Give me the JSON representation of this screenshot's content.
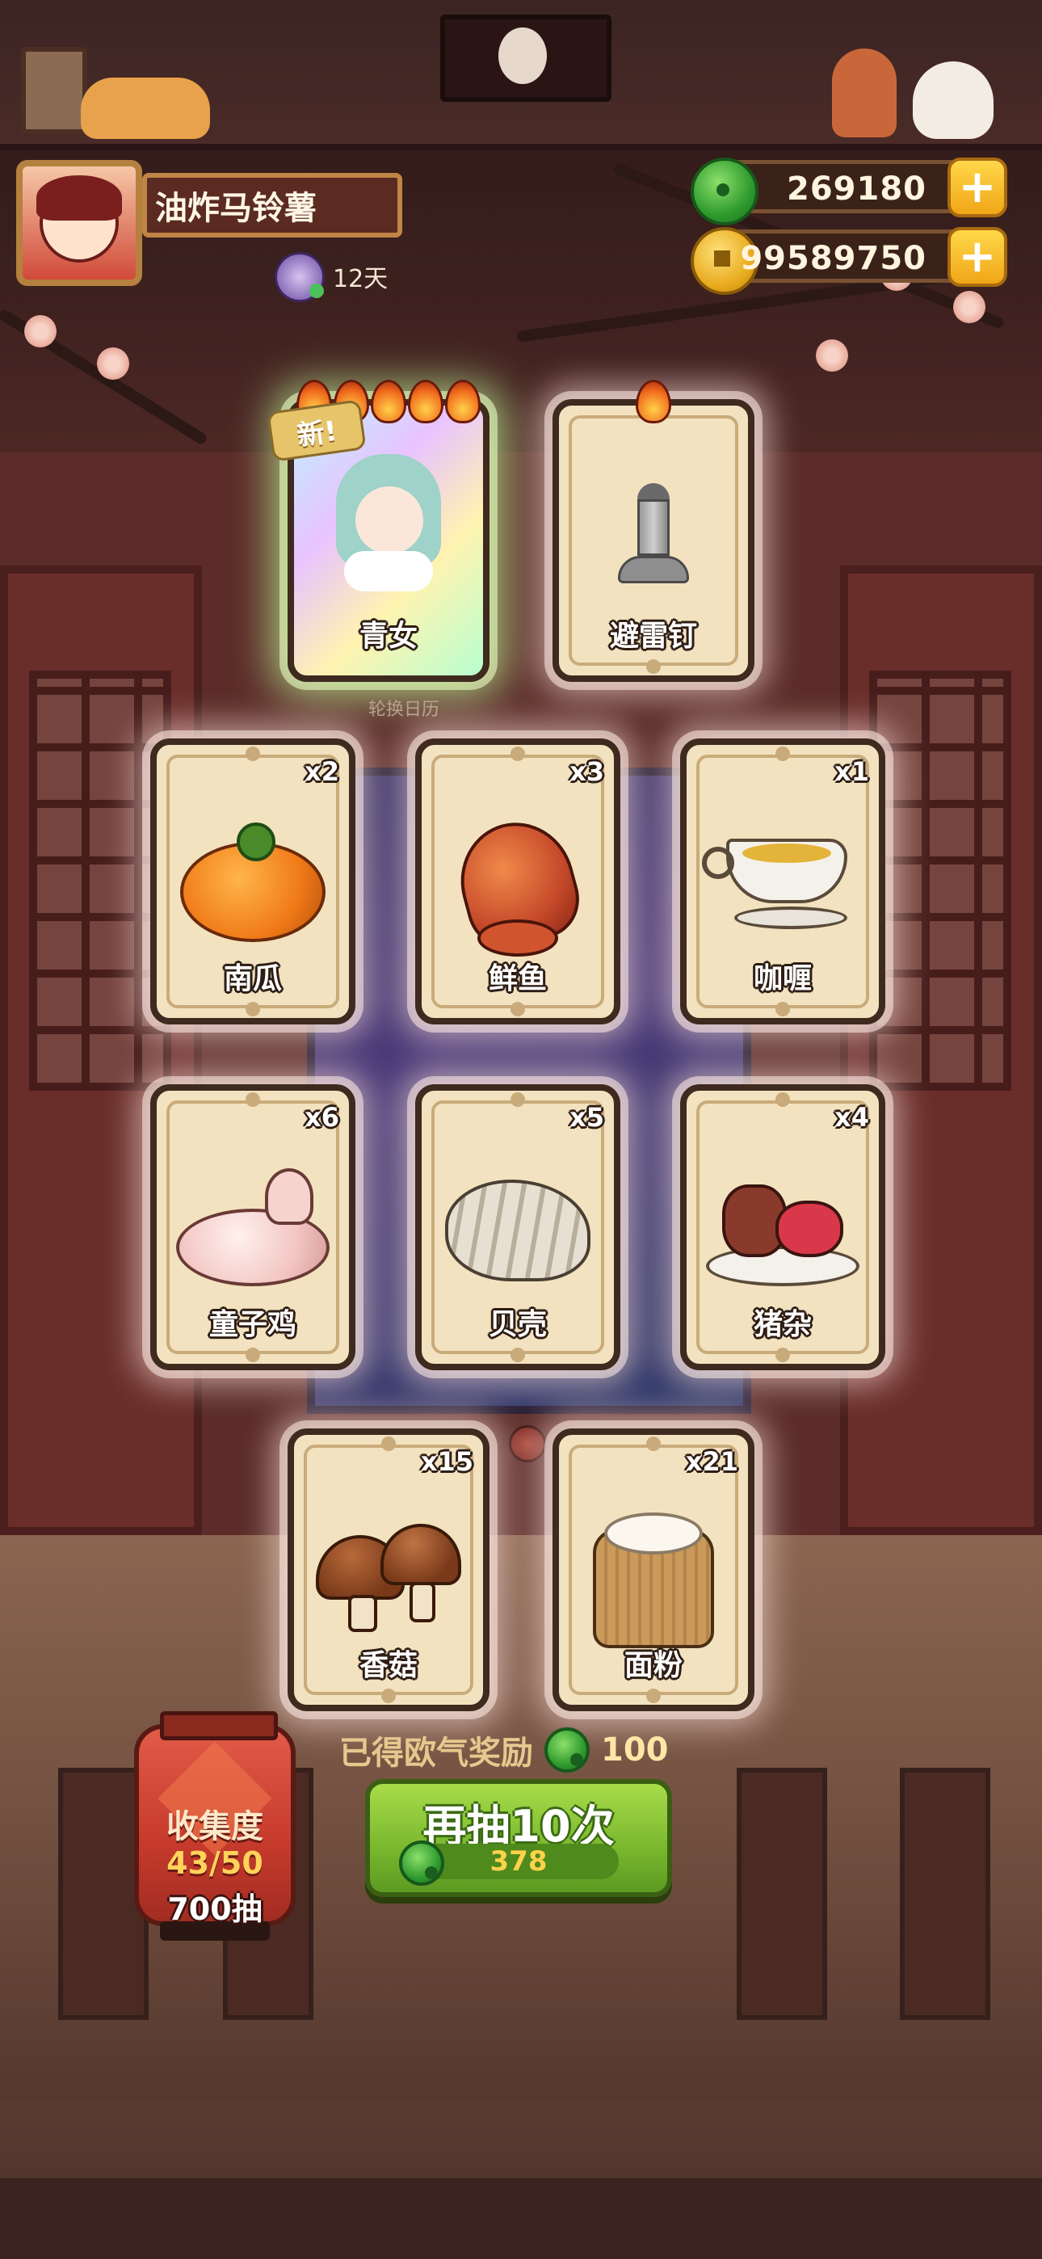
{
  "player": {
    "name": "油炸马铃薯",
    "days": "12天"
  },
  "currency": {
    "jade": "269180",
    "coins": "99589750",
    "add_symbol": "+"
  },
  "featured_cards": [
    {
      "label": "青女",
      "rarity_flames": 5,
      "badge": "新!",
      "icon": "blue-haired-girl-icon"
    },
    {
      "label": "避雷钉",
      "rarity_flames": 1,
      "icon": "lightning-rod-icon"
    }
  ],
  "caption": "轮换日历",
  "item_cards": [
    {
      "label": "南瓜",
      "count": "x2",
      "icon": "pumpkin-icon"
    },
    {
      "label": "鲜鱼",
      "count": "x3",
      "icon": "fish-icon"
    },
    {
      "label": "咖喱",
      "count": "x1",
      "icon": "curry-gravy-boat-icon"
    },
    {
      "label": "童子鸡",
      "count": "x6",
      "icon": "raw-chicken-icon"
    },
    {
      "label": "贝壳",
      "count": "x5",
      "icon": "clam-shell-icon"
    },
    {
      "label": "猪杂",
      "count": "x4",
      "icon": "pork-offal-plate-icon"
    },
    {
      "label": "香菇",
      "count": "x15",
      "icon": "mushroom-icon"
    },
    {
      "label": "面粉",
      "count": "x21",
      "icon": "flour-sack-icon"
    }
  ],
  "reward": {
    "label": "已得欧气奖励",
    "value": "100"
  },
  "draw_button": {
    "label": "再抽10次",
    "cost": "378"
  },
  "collection": {
    "title": "收集度",
    "progress": "43/50",
    "draws": "700抽"
  },
  "colors": {
    "draw_button": "#79b72e",
    "lantern": "#c63a2c",
    "card_bg": "#f3e2bf",
    "jade": "#2f9b2e",
    "coin": "#e7a91c"
  }
}
